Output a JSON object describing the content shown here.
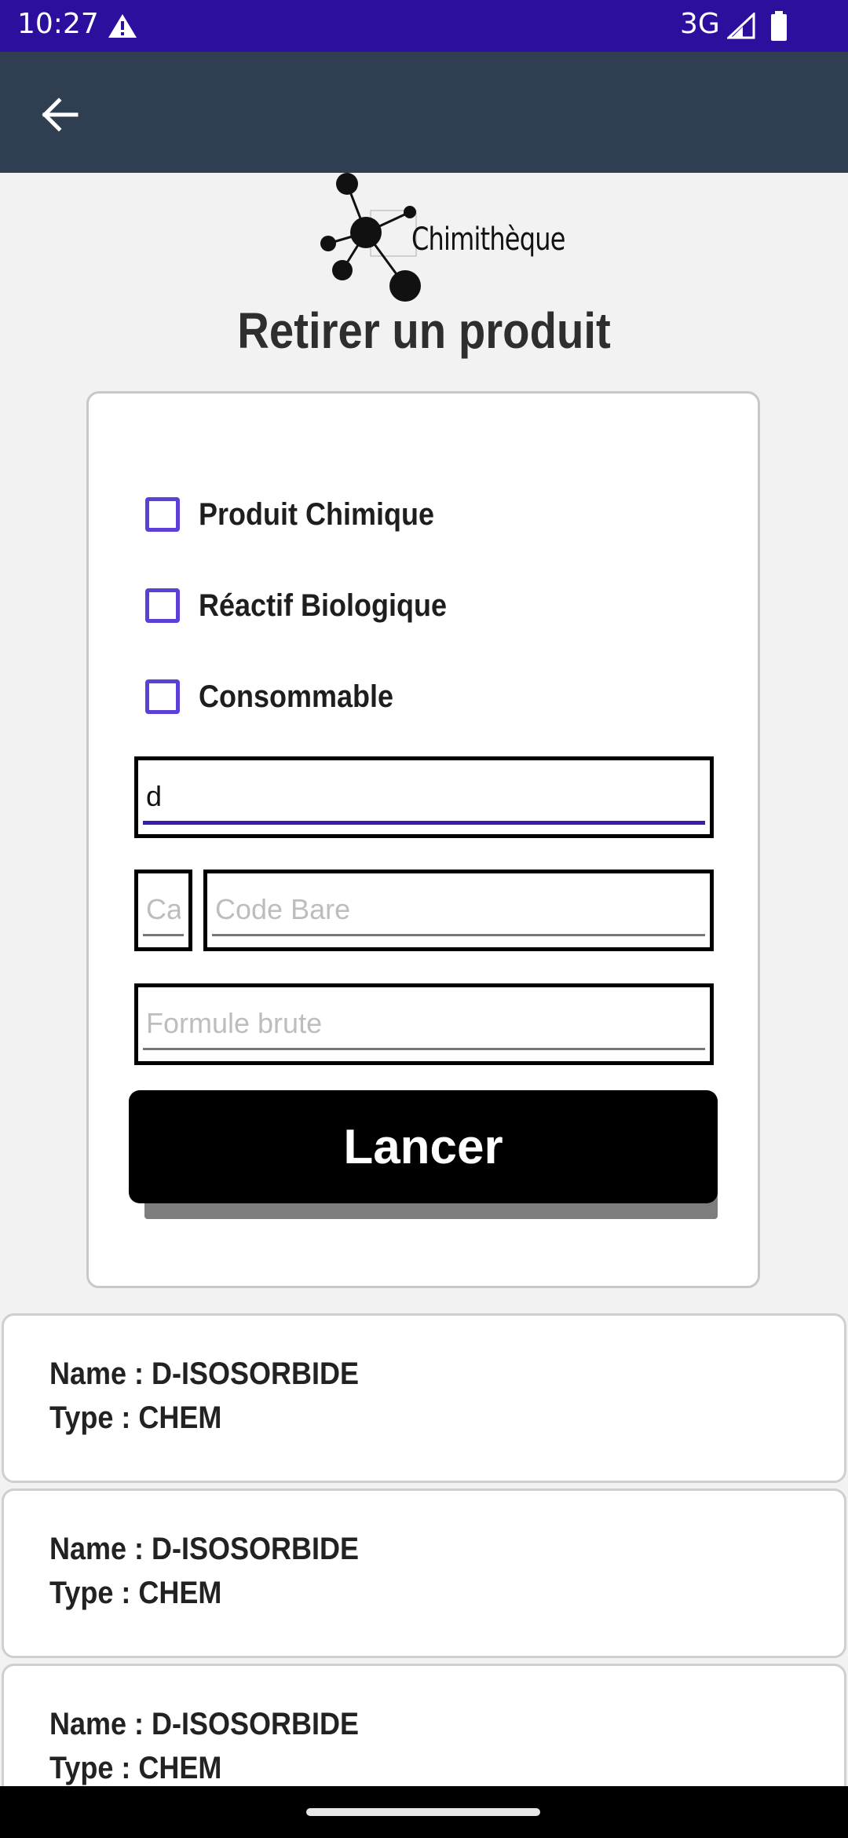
{
  "status_bar": {
    "time": "10:27",
    "network": "3G",
    "icons": [
      "alert-icon",
      "signal-icon",
      "battery-icon"
    ]
  },
  "app_bar": {
    "back_icon": "arrow-left-icon"
  },
  "logo": {
    "text": "Chimithèque"
  },
  "page": {
    "title": "Retirer un produit"
  },
  "form": {
    "checkboxes": [
      {
        "label": "Produit Chimique",
        "checked": false
      },
      {
        "label": "Réactif Biologique",
        "checked": false
      },
      {
        "label": "Consommable",
        "checked": false
      }
    ],
    "search": {
      "value": "d"
    },
    "cas": {
      "placeholder": "Cas"
    },
    "barcode": {
      "placeholder": "Code Bare"
    },
    "formula": {
      "placeholder": "Formule brute"
    },
    "launch_label": "Lancer"
  },
  "results": [
    {
      "name": "Name :  D-ISOSORBIDE",
      "type": "Type : CHEM"
    },
    {
      "name": "Name :  D-ISOSORBIDE",
      "type": "Type : CHEM"
    },
    {
      "name": "Name :  D-ISOSORBIDE",
      "type": "Type : CHEM"
    }
  ],
  "colors": {
    "status_bar": "#2d0f9e",
    "app_bar": "#2f3e51",
    "checkbox_accent": "#5b3fd6",
    "button": "#000000"
  }
}
